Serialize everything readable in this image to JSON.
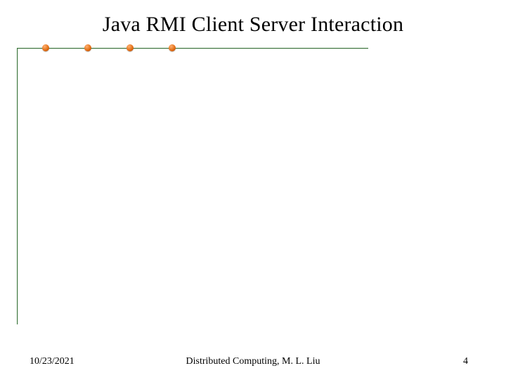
{
  "title": "Java RMI Client Server Interaction",
  "footer": {
    "date": "10/23/2021",
    "center": "Distributed Computing, M. L. Liu",
    "page": "4"
  }
}
